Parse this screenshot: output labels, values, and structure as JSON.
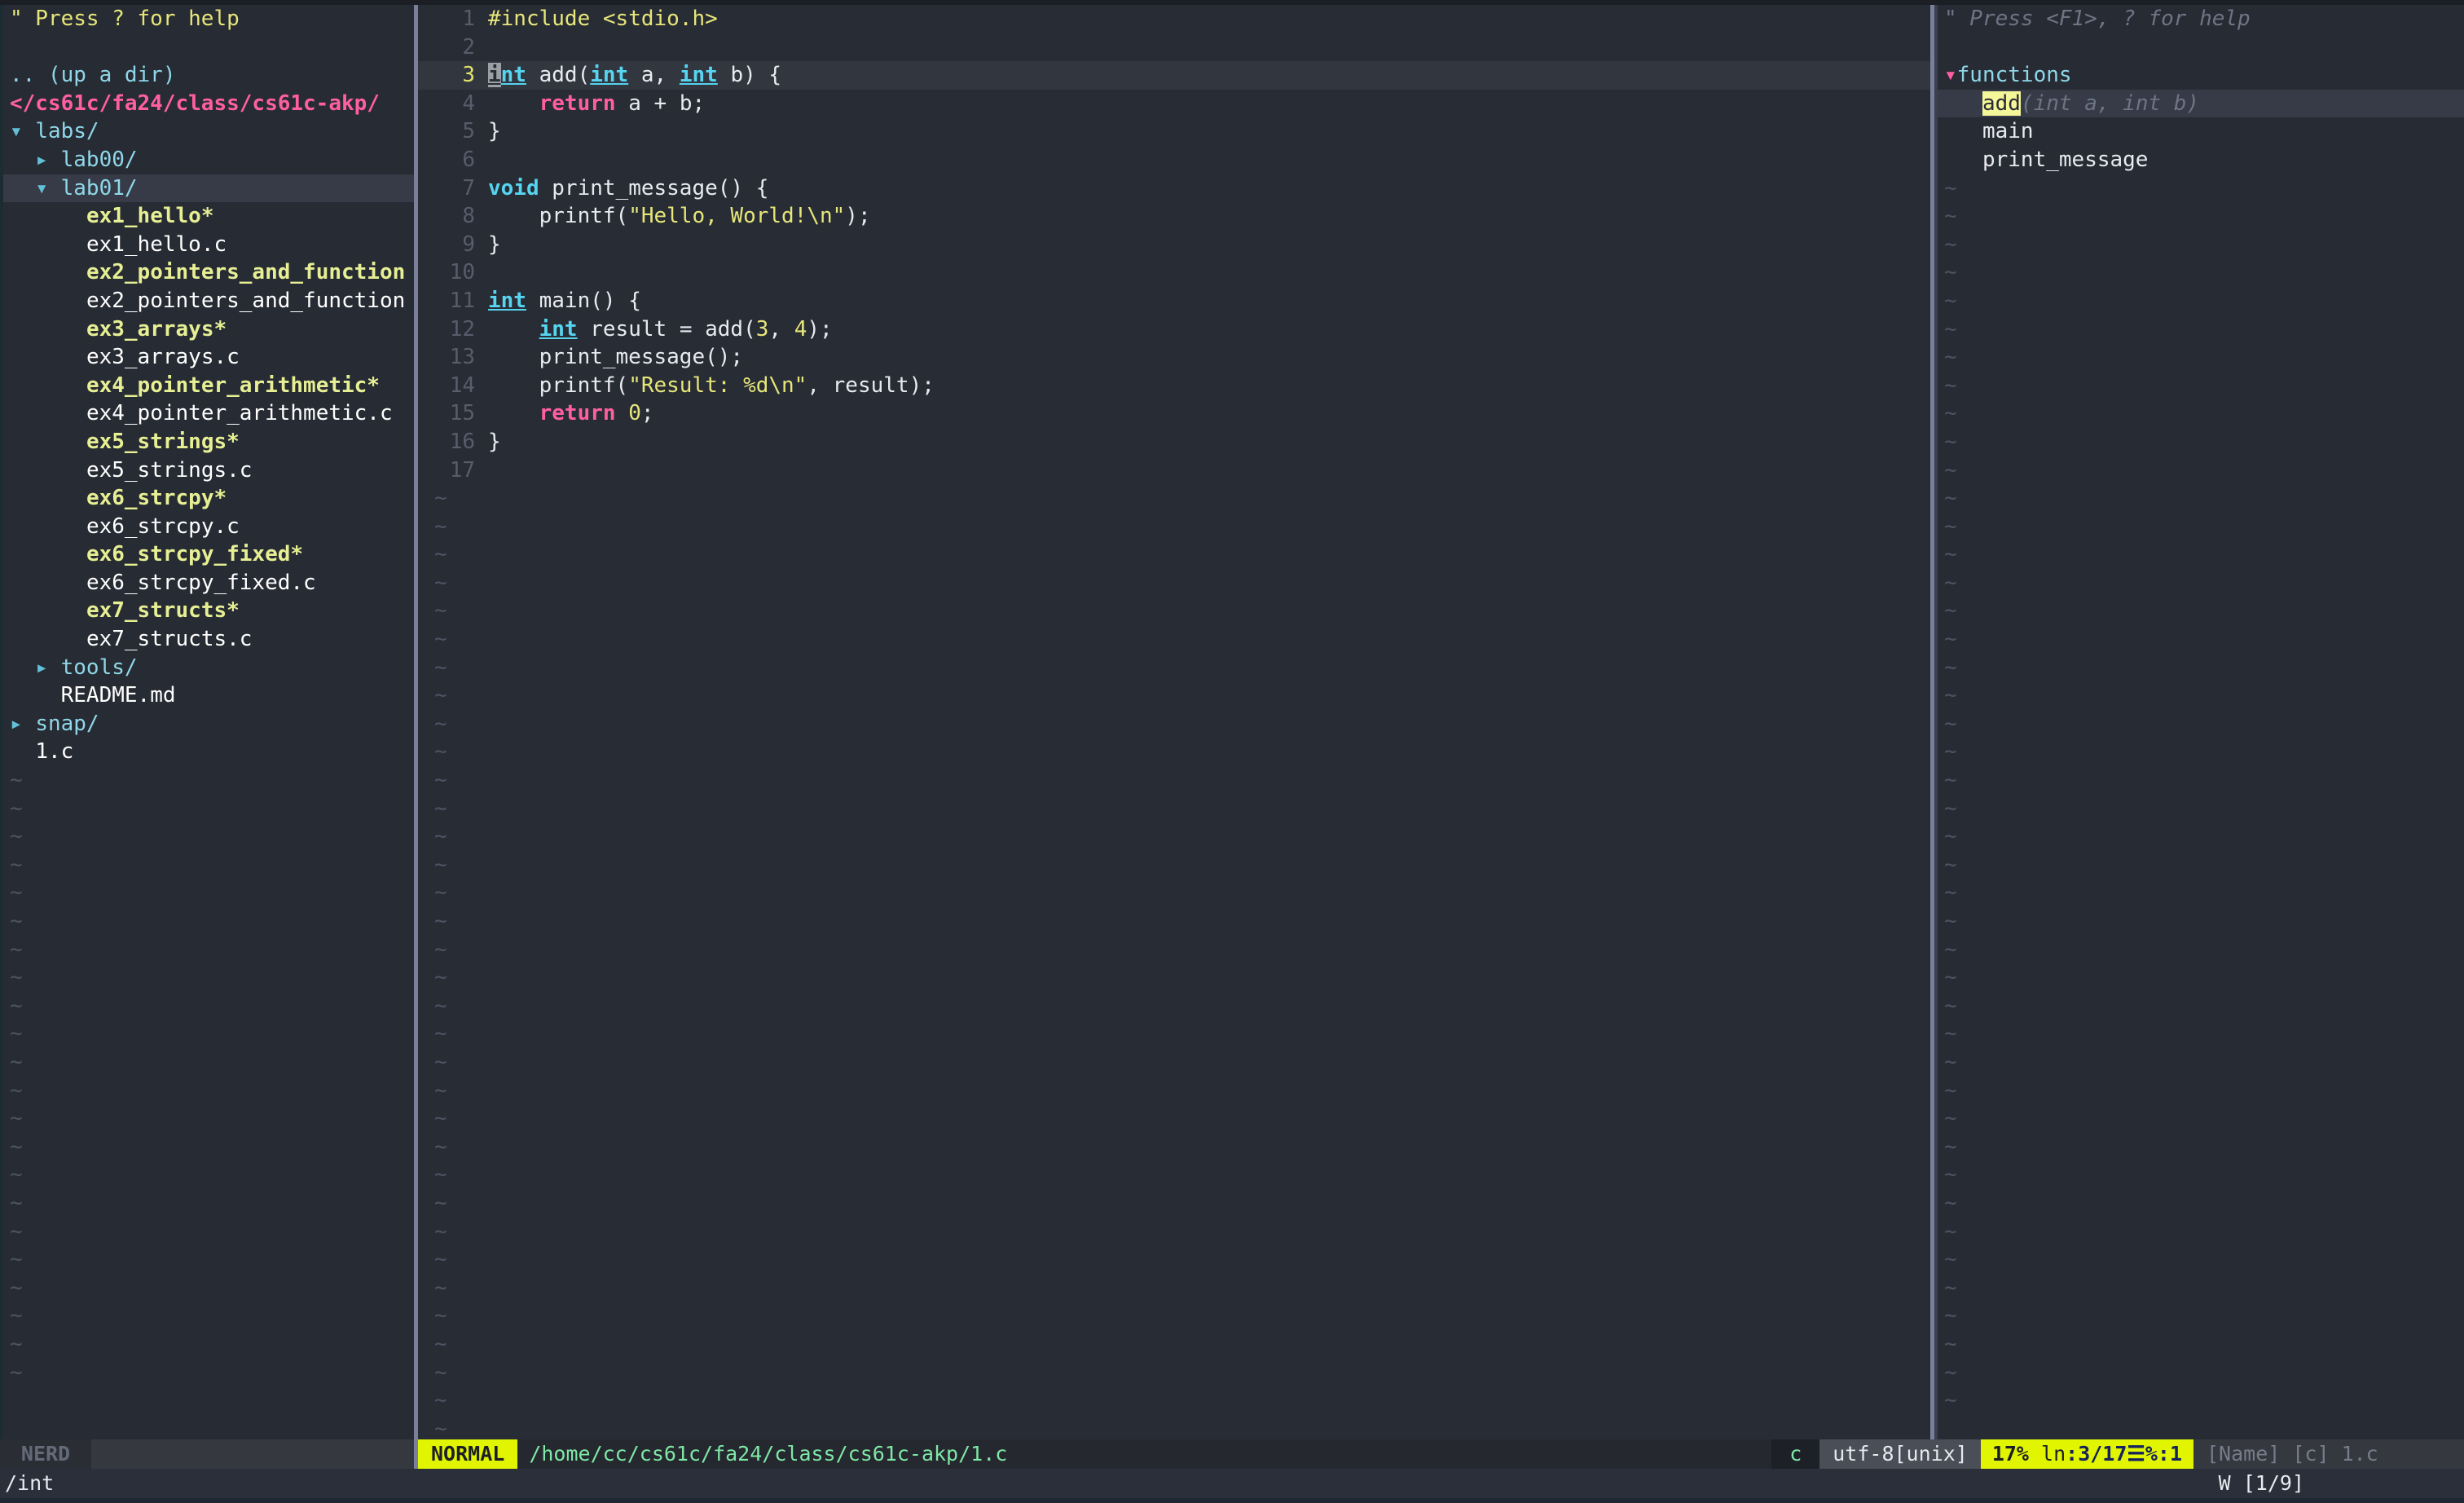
{
  "app": {
    "name": "vim",
    "theme": "dark",
    "colors": {
      "background": "#282c34",
      "sidebar_background": "#272b33",
      "cursorline": "#363b47",
      "accent_pink": "#ff5fa2",
      "accent_cyan": "#56d4f0",
      "accent_yellow": "#e6e67a",
      "status_mode": "#e1f500",
      "status_path_text": "#7ee8a6",
      "search_highlight": "#f5f59a"
    }
  },
  "nerdtree": {
    "help_hint": "\" Press ? for help",
    "up_a_dir": ".. (up a dir)",
    "root_path": "</cs61c/fa24/class/cs61c-akp/",
    "status_label": "NERD",
    "items": [
      {
        "arrow": "▾",
        "label": "labs/",
        "type": "dir",
        "indent": 0,
        "selected": false
      },
      {
        "arrow": "▸",
        "label": "lab00/",
        "type": "dir",
        "indent": 1,
        "selected": false
      },
      {
        "arrow": "▾",
        "label": "lab01/",
        "type": "dir",
        "indent": 1,
        "selected": true
      },
      {
        "arrow": "",
        "label": "ex1_hello*",
        "type": "exec",
        "indent": 2,
        "selected": false
      },
      {
        "arrow": "",
        "label": "ex1_hello.c",
        "type": "file",
        "indent": 2,
        "selected": false
      },
      {
        "arrow": "",
        "label": "ex2_pointers_and_function",
        "type": "exec",
        "indent": 2,
        "selected": false
      },
      {
        "arrow": "",
        "label": "ex2_pointers_and_function",
        "type": "file",
        "indent": 2,
        "selected": false
      },
      {
        "arrow": "",
        "label": "ex3_arrays*",
        "type": "exec",
        "indent": 2,
        "selected": false
      },
      {
        "arrow": "",
        "label": "ex3_arrays.c",
        "type": "file",
        "indent": 2,
        "selected": false
      },
      {
        "arrow": "",
        "label": "ex4_pointer_arithmetic*",
        "type": "exec",
        "indent": 2,
        "selected": false
      },
      {
        "arrow": "",
        "label": "ex4_pointer_arithmetic.c",
        "type": "file",
        "indent": 2,
        "selected": false
      },
      {
        "arrow": "",
        "label": "ex5_strings*",
        "type": "exec",
        "indent": 2,
        "selected": false
      },
      {
        "arrow": "",
        "label": "ex5_strings.c",
        "type": "file",
        "indent": 2,
        "selected": false
      },
      {
        "arrow": "",
        "label": "ex6_strcpy*",
        "type": "exec",
        "indent": 2,
        "selected": false
      },
      {
        "arrow": "",
        "label": "ex6_strcpy.c",
        "type": "file",
        "indent": 2,
        "selected": false
      },
      {
        "arrow": "",
        "label": "ex6_strcpy_fixed*",
        "type": "exec",
        "indent": 2,
        "selected": false
      },
      {
        "arrow": "",
        "label": "ex6_strcpy_fixed.c",
        "type": "file",
        "indent": 2,
        "selected": false
      },
      {
        "arrow": "",
        "label": "ex7_structs*",
        "type": "exec",
        "indent": 2,
        "selected": false
      },
      {
        "arrow": "",
        "label": "ex7_structs.c",
        "type": "file",
        "indent": 2,
        "selected": false
      },
      {
        "arrow": "▸",
        "label": "tools/",
        "type": "dir",
        "indent": 1,
        "selected": false
      },
      {
        "arrow": "",
        "label": "README.md",
        "type": "file",
        "indent": 1,
        "selected": false
      },
      {
        "arrow": "▸",
        "label": "snap/",
        "type": "dir",
        "indent": 0,
        "selected": false
      },
      {
        "arrow": "",
        "label": "1.c",
        "type": "file",
        "indent": 0,
        "selected": false
      }
    ]
  },
  "editor": {
    "filename": "1.c",
    "cursor_line": 3,
    "cursor_col": 1,
    "total_lines": 17,
    "lines": [
      {
        "n": "1",
        "tokens": [
          {
            "t": "#include ",
            "c": "s-pre"
          },
          {
            "t": "<stdio.h>",
            "c": "s-inc"
          }
        ]
      },
      {
        "n": "2",
        "tokens": []
      },
      {
        "n": "3",
        "current": true,
        "tokens": [
          {
            "t": "i",
            "c": "cursor-blk s-type-u"
          },
          {
            "t": "nt",
            "c": "s-type-u"
          },
          {
            "t": " add(",
            "c": "s-plain"
          },
          {
            "t": "int",
            "c": "s-type-u"
          },
          {
            "t": " a, ",
            "c": "s-plain"
          },
          {
            "t": "int",
            "c": "s-type-u"
          },
          {
            "t": " b) {",
            "c": "s-plain"
          }
        ]
      },
      {
        "n": "4",
        "tokens": [
          {
            "t": "    ",
            "c": "s-plain"
          },
          {
            "t": "return",
            "c": "s-kw"
          },
          {
            "t": " a + b;",
            "c": "s-plain"
          }
        ]
      },
      {
        "n": "5",
        "tokens": [
          {
            "t": "}",
            "c": "s-plain"
          }
        ]
      },
      {
        "n": "6",
        "tokens": []
      },
      {
        "n": "7",
        "tokens": [
          {
            "t": "void",
            "c": "s-type"
          },
          {
            "t": " print_message() {",
            "c": "s-plain"
          }
        ]
      },
      {
        "n": "8",
        "tokens": [
          {
            "t": "    printf(",
            "c": "s-plain"
          },
          {
            "t": "\"Hello, World!\\n\"",
            "c": "s-str"
          },
          {
            "t": ");",
            "c": "s-plain"
          }
        ]
      },
      {
        "n": "9",
        "tokens": [
          {
            "t": "}",
            "c": "s-plain"
          }
        ]
      },
      {
        "n": "10",
        "tokens": []
      },
      {
        "n": "11",
        "tokens": [
          {
            "t": "int",
            "c": "s-type-u"
          },
          {
            "t": " main() {",
            "c": "s-plain"
          }
        ]
      },
      {
        "n": "12",
        "tokens": [
          {
            "t": "    ",
            "c": "s-plain"
          },
          {
            "t": "int",
            "c": "s-type-u"
          },
          {
            "t": " result = add(",
            "c": "s-plain"
          },
          {
            "t": "3",
            "c": "s-num"
          },
          {
            "t": ", ",
            "c": "s-plain"
          },
          {
            "t": "4",
            "c": "s-num"
          },
          {
            "t": ");",
            "c": "s-plain"
          }
        ]
      },
      {
        "n": "13",
        "tokens": [
          {
            "t": "    print_message();",
            "c": "s-plain"
          }
        ]
      },
      {
        "n": "14",
        "tokens": [
          {
            "t": "    printf(",
            "c": "s-plain"
          },
          {
            "t": "\"Result: %d\\n\"",
            "c": "s-str"
          },
          {
            "t": ", result);",
            "c": "s-plain"
          }
        ]
      },
      {
        "n": "15",
        "tokens": [
          {
            "t": "    ",
            "c": "s-plain"
          },
          {
            "t": "return",
            "c": "s-kw"
          },
          {
            "t": " ",
            "c": "s-plain"
          },
          {
            "t": "0",
            "c": "s-num"
          },
          {
            "t": ";",
            "c": "s-plain"
          }
        ]
      },
      {
        "n": "16",
        "tokens": [
          {
            "t": "}",
            "c": "s-plain"
          }
        ]
      },
      {
        "n": "17",
        "tokens": []
      }
    ]
  },
  "tagbar": {
    "help_hint": "\" Press <F1>, ? for help",
    "kind_arrow": "▾",
    "kind_label": "functions",
    "tags": [
      {
        "name": "add",
        "signature": "(int a, int b)",
        "highlighted": true,
        "selected": true
      },
      {
        "name": "main",
        "signature": "",
        "highlighted": false,
        "selected": false
      },
      {
        "name": "print_message",
        "signature": "",
        "highlighted": false,
        "selected": false
      }
    ],
    "status_label": "[Name] [c] 1.c"
  },
  "statusline": {
    "mode": "NORMAL",
    "file_path": "/home/cc/cs61c/fa24/class/cs61c-akp/1.c",
    "filetype": "c",
    "encoding": "utf-8[unix]",
    "percent": "17%",
    "line_label": "ln",
    "line_value": ":3/17",
    "col_symbol": "☰",
    "col_value": "%:1"
  },
  "cmdline": {
    "left_text": "/int",
    "right_text": "W [1/9]"
  },
  "tilde": "~"
}
